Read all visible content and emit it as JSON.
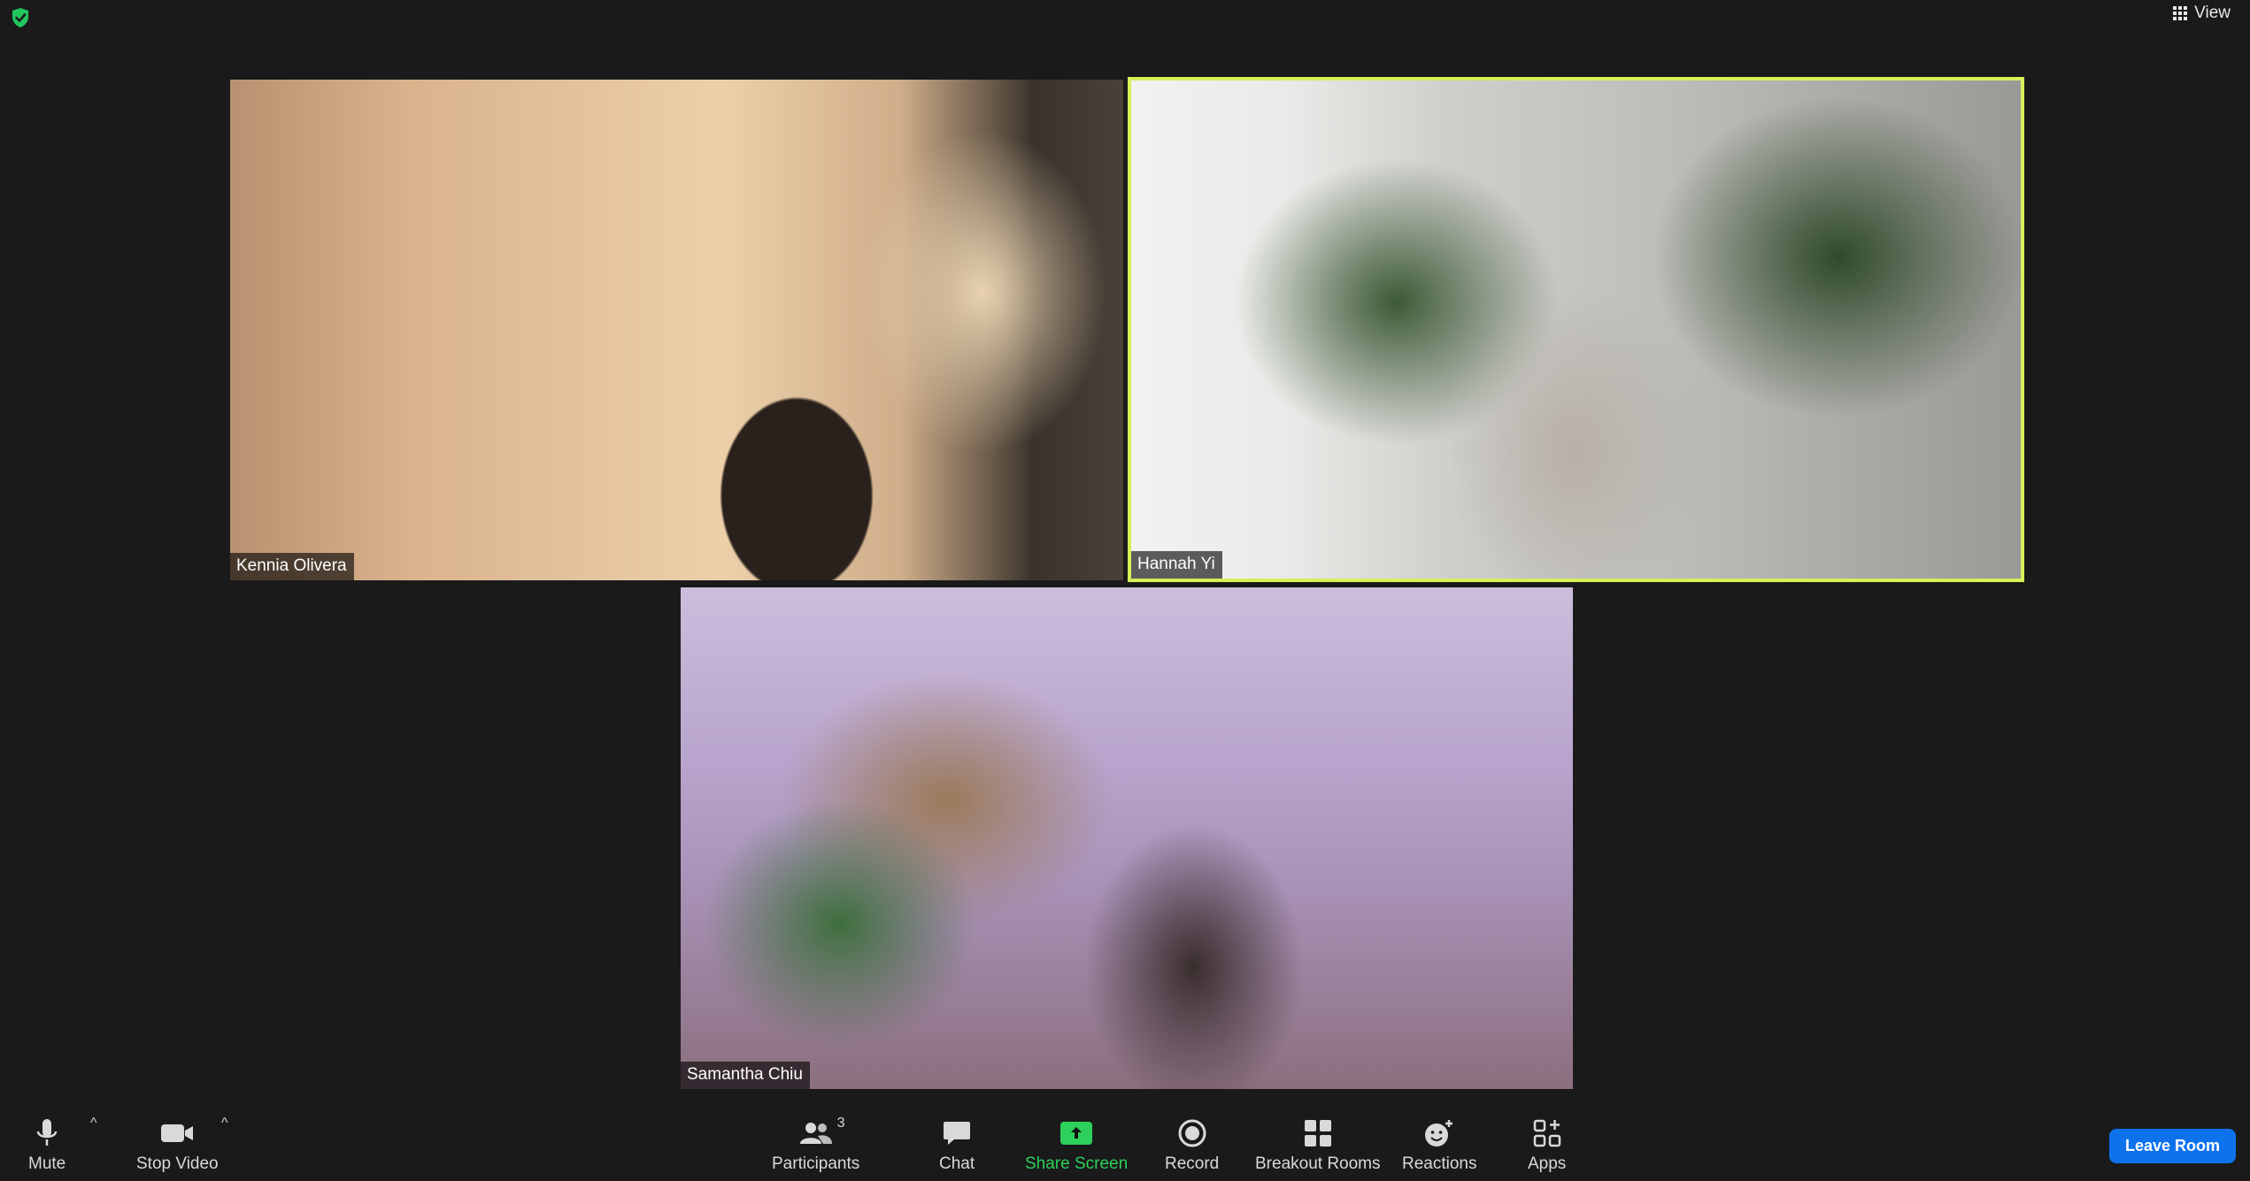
{
  "top": {
    "view_label": "View"
  },
  "participants": [
    {
      "name": "Kennia Olivera"
    },
    {
      "name": "Hannah Yi"
    },
    {
      "name": "Samantha Chiu"
    }
  ],
  "toolbar": {
    "mute_label": "Mute",
    "stop_video_label": "Stop Video",
    "participants_label": "Participants",
    "participants_count": "3",
    "chat_label": "Chat",
    "share_screen_label": "Share Screen",
    "record_label": "Record",
    "breakout_rooms_label": "Breakout Rooms",
    "reactions_label": "Reactions",
    "apps_label": "Apps",
    "leave_label": "Leave Room"
  },
  "colors": {
    "active_speaker_border": "#d6f05a",
    "share_green": "#2dd05b",
    "leave_blue": "#0e72ed",
    "background": "#1a1a1a"
  },
  "icons": [
    "shield-icon",
    "grid-view-icon",
    "microphone-icon",
    "video-camera-icon",
    "participants-icon",
    "chat-icon",
    "share-screen-icon",
    "record-icon",
    "breakout-rooms-icon",
    "reactions-icon",
    "apps-icon"
  ]
}
